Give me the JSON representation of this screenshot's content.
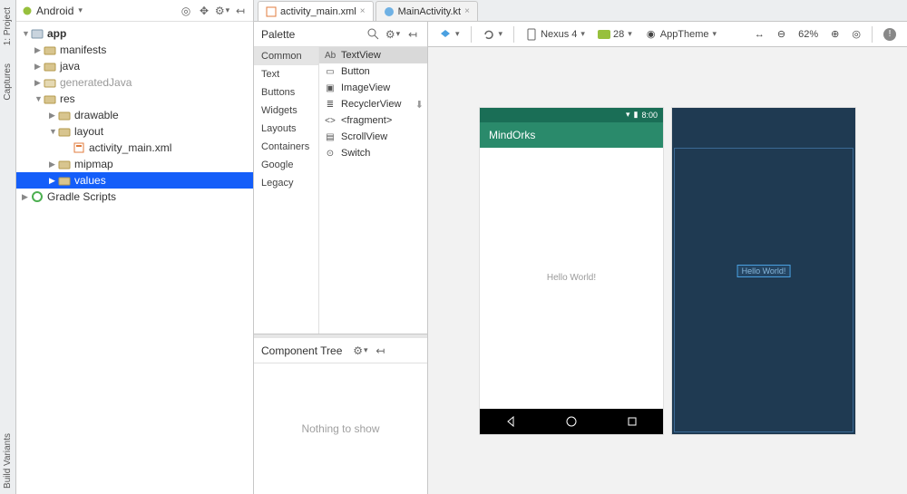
{
  "leftSideTabs": [
    "1: Project",
    "Captures",
    "Build Variants"
  ],
  "projectPanel": {
    "viewMode": "Android",
    "tree": {
      "app": "app",
      "manifests": "manifests",
      "java": "java",
      "generatedJava": "generatedJava",
      "res": "res",
      "drawable": "drawable",
      "layout": "layout",
      "activity_main": "activity_main.xml",
      "mipmap": "mipmap",
      "values": "values",
      "gradle": "Gradle Scripts"
    }
  },
  "editorTabs": [
    {
      "label": "activity_main.xml",
      "active": true
    },
    {
      "label": "MainActivity.kt",
      "active": false
    }
  ],
  "palette": {
    "title": "Palette",
    "categories": [
      "Common",
      "Text",
      "Buttons",
      "Widgets",
      "Layouts",
      "Containers",
      "Google",
      "Legacy"
    ],
    "selectedCategory": "Common",
    "items": [
      {
        "icon": "Ab",
        "label": "TextView",
        "selected": true
      },
      {
        "icon": "▭",
        "label": "Button"
      },
      {
        "icon": "▣",
        "label": "ImageView"
      },
      {
        "icon": "≣",
        "label": "RecyclerView",
        "download": true
      },
      {
        "icon": "<>",
        "label": "<fragment>"
      },
      {
        "icon": "▤",
        "label": "ScrollView"
      },
      {
        "icon": "⊙",
        "label": "Switch"
      }
    ]
  },
  "componentTree": {
    "title": "Component Tree",
    "empty": "Nothing to show"
  },
  "designToolbar": {
    "device": "Nexus 4",
    "api": "28",
    "theme": "AppTheme",
    "zoom": "62%"
  },
  "devicePreview": {
    "statusTime": "8:00",
    "appTitle": "MindOrks",
    "bodyText": "Hello World!",
    "blueprintText": "Hello World!"
  },
  "colors": {
    "selection": "#145ef9",
    "appbar": "#2a8a6b",
    "statusbar": "#1a6e56",
    "blueprint": "#1f3a52"
  }
}
